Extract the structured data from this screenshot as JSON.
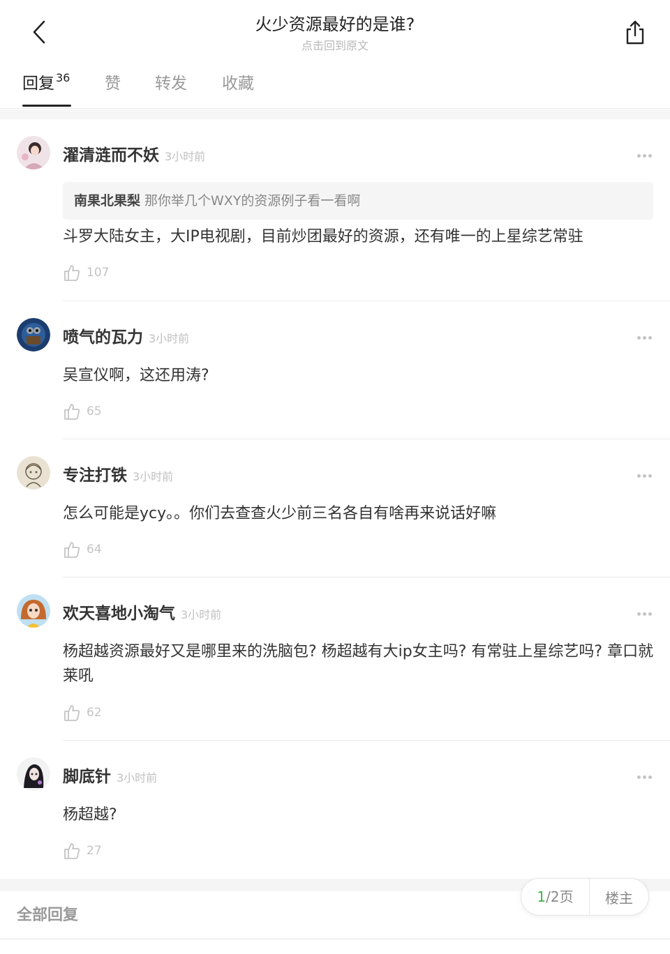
{
  "header": {
    "title": "火少资源最好的是谁?",
    "subtitle": "点击回到原文",
    "back_icon": "chevron-left-icon",
    "share_icon": "share-icon"
  },
  "tabs": [
    {
      "label": "回复",
      "count": "36",
      "active": true
    },
    {
      "label": "赞"
    },
    {
      "label": "转发"
    },
    {
      "label": "收藏"
    }
  ],
  "comments": [
    {
      "user": "濯清涟而不妖",
      "time": "3小时前",
      "quote_user": "南果北果梨",
      "quote_text": "那你举几个WXY的资源例子看一看啊",
      "text": "斗罗大陆女主，大IP电视剧，目前炒团最好的资源，还有唯一的上星综艺常驻",
      "likes": "107"
    },
    {
      "user": "喷气的瓦力",
      "time": "3小时前",
      "text": "吴宣仪啊，这还用涛?",
      "likes": "65"
    },
    {
      "user": "专注打铁",
      "time": "3小时前",
      "text": "怎么可能是ycy。。你们去查查火少前三名各自有啥再来说话好嘛",
      "likes": "64"
    },
    {
      "user": "欢天喜地小淘气",
      "time": "3小时前",
      "text": "杨超越资源最好又是哪里来的洗脑包? 杨超越有大ip女主吗? 有常驻上星综艺吗? 章口就莱吼",
      "likes": "62"
    },
    {
      "user": "脚底针",
      "time": "3小时前",
      "text": "杨超越?",
      "likes": "27"
    }
  ],
  "footer": {
    "all_replies": "全部回复",
    "pager_current": "1",
    "pager_total": "/2页",
    "pager_op": "楼主"
  },
  "colors": {
    "accent_green": "#39b54a",
    "muted": "#c0c0c0"
  }
}
